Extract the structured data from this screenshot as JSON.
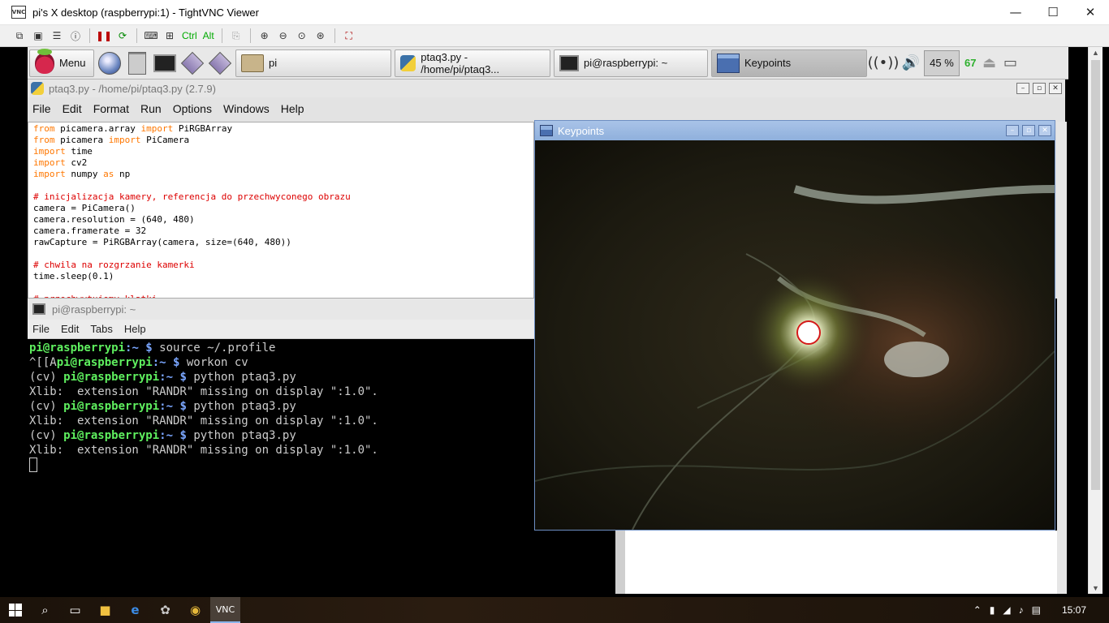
{
  "vnc": {
    "title": "pi's X desktop (raspberrypi:1) - TightVNC Viewer",
    "app_icon": "VNC",
    "controls": {
      "minimize": "—",
      "maximize": "☐",
      "close": "✕"
    },
    "toolbar": {
      "ctrl": "Ctrl",
      "alt": "Alt"
    }
  },
  "panel": {
    "menu_label": "Menu",
    "tasks": [
      {
        "label": "pi",
        "icon": "folder-icon"
      },
      {
        "label": "ptaq3.py - /home/pi/ptaq3...",
        "icon": "python-icon"
      },
      {
        "label": "pi@raspberrypi: ~",
        "icon": "terminal-icon"
      },
      {
        "label": "Keypoints",
        "icon": "window-icon",
        "active": true
      }
    ],
    "cpu": "45 %",
    "temp": "67"
  },
  "idle": {
    "title": "ptaq3.py - /home/pi/ptaq3.py (2.7.9)",
    "menu": [
      "File",
      "Edit",
      "Format",
      "Run",
      "Options",
      "Windows",
      "Help"
    ],
    "code": [
      [
        {
          "t": "from",
          "c": "kw"
        },
        {
          "t": " picamera.array "
        },
        {
          "t": "import",
          "c": "kw"
        },
        {
          "t": " PiRGBArray"
        }
      ],
      [
        {
          "t": "from",
          "c": "kw"
        },
        {
          "t": " picamera "
        },
        {
          "t": "import",
          "c": "kw"
        },
        {
          "t": " PiCamera"
        }
      ],
      [
        {
          "t": "import",
          "c": "kw"
        },
        {
          "t": " time"
        }
      ],
      [
        {
          "t": "import",
          "c": "kw"
        },
        {
          "t": " cv2"
        }
      ],
      [
        {
          "t": "import",
          "c": "kw"
        },
        {
          "t": " numpy "
        },
        {
          "t": "as",
          "c": "kw"
        },
        {
          "t": " np"
        }
      ],
      [],
      [
        {
          "t": "# inicjalizacja kamery, referencja do przechwyconego obrazu",
          "c": "cm"
        }
      ],
      [
        {
          "t": "camera = PiCamera()"
        }
      ],
      [
        {
          "t": "camera.resolution = (640, 480)"
        }
      ],
      [
        {
          "t": "camera.framerate = 32"
        }
      ],
      [
        {
          "t": "rawCapture = PiRGBArray(camera, size=(640, 480))"
        }
      ],
      [],
      [
        {
          "t": "# chwila na rozgrzanie kamerki",
          "c": "cm"
        }
      ],
      [
        {
          "t": "time.sleep(0.1)"
        }
      ],
      [],
      [
        {
          "t": "# przechwytujemy klatki",
          "c": "cm"
        }
      ]
    ]
  },
  "terminal": {
    "title": "pi@raspberrypi: ~",
    "menu": [
      "File",
      "Edit",
      "Tabs",
      "Help"
    ],
    "lines": [
      [
        {
          "t": "pi@raspberrypi",
          "c": "pg"
        },
        {
          "t": ":~ $",
          "c": "pb"
        },
        {
          "t": " source ~/.profile"
        }
      ],
      [
        {
          "t": "^[[A"
        },
        {
          "t": "pi@raspberrypi",
          "c": "pg"
        },
        {
          "t": ":~ $",
          "c": "pb"
        },
        {
          "t": " workon cv"
        }
      ],
      [
        {
          "t": "(cv) "
        },
        {
          "t": "pi@raspberrypi",
          "c": "pg"
        },
        {
          "t": ":~ $",
          "c": "pb"
        },
        {
          "t": " python ptaq3.py"
        }
      ],
      [
        {
          "t": "Xlib:  extension \"RANDR\" missing on display \":1.0\"."
        }
      ],
      [
        {
          "t": "(cv) "
        },
        {
          "t": "pi@raspberrypi",
          "c": "pg"
        },
        {
          "t": ":~ $",
          "c": "pb"
        },
        {
          "t": " python ptaq3.py"
        }
      ],
      [
        {
          "t": "Xlib:  extension \"RANDR\" missing on display \":1.0\"."
        }
      ],
      [
        {
          "t": "(cv) "
        },
        {
          "t": "pi@raspberrypi",
          "c": "pg"
        },
        {
          "t": ":~ $",
          "c": "pb"
        },
        {
          "t": " python ptaq3.py"
        }
      ],
      [
        {
          "t": "Xlib:  extension \"RANDR\" missing on display \":1.0\"."
        }
      ]
    ]
  },
  "keypoints": {
    "title": "Keypoints"
  },
  "taskbar": {
    "clock": "15:07"
  }
}
